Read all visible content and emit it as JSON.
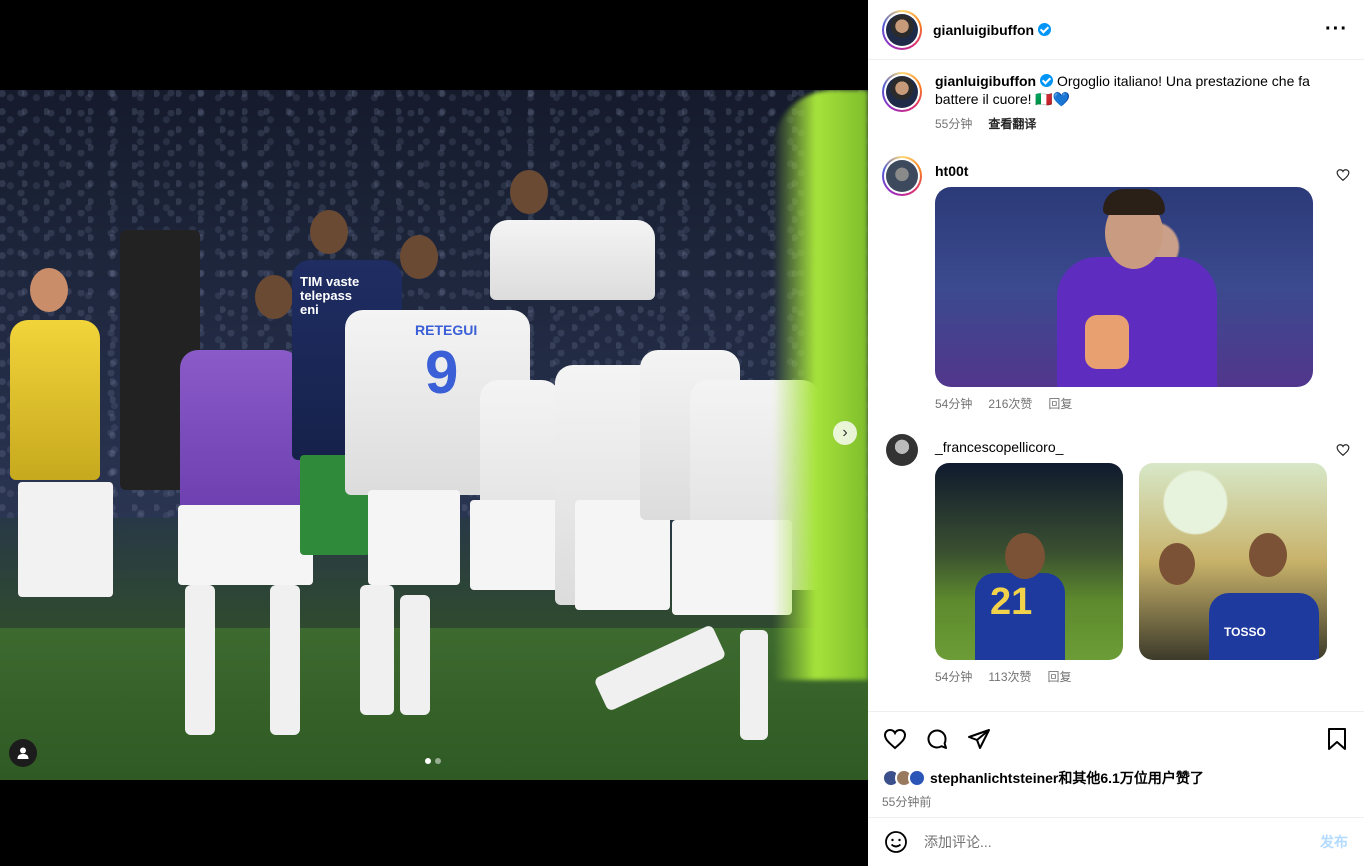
{
  "post": {
    "author": "gianluigibuffon",
    "more_label": "···"
  },
  "caption": {
    "user": "gianluigibuffon",
    "text": "Orgoglio italiano! Una prestazione che fa battere il cuore! 🇮🇹💙",
    "time": "55分钟",
    "translate": "查看翻译"
  },
  "comments": [
    {
      "user": "ht00t",
      "time": "54分钟",
      "likes": "216次赞",
      "reply": "回复"
    },
    {
      "user": "_francescopellicoro_",
      "time": "54分钟",
      "likes": "113次赞",
      "reply": "回复"
    }
  ],
  "photo": {
    "jersey_name": "RETEGUI",
    "jersey_number": "9",
    "sponsor_text": "TIM vaste telepass eni",
    "twin_jersey": "21",
    "twin_text": "TOSSO"
  },
  "likes": {
    "text": "stephanlichtsteiner和其他6.1万位用户赞了",
    "time": "55分钟前"
  },
  "comment_box": {
    "placeholder": "添加评论...",
    "post_label": "发布"
  },
  "carousel": {
    "total": 2,
    "active": 1
  },
  "colors": {
    "verified": "#0095f6",
    "link_disabled": "#b3dbff",
    "meta_gray": "#737373"
  }
}
